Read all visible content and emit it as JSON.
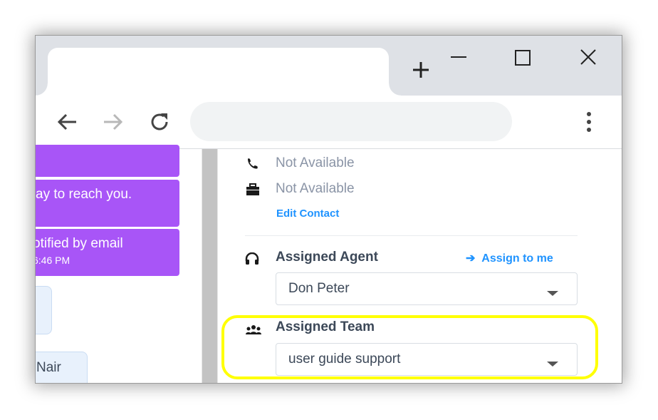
{
  "browser": {
    "new_tab_symbol": "+",
    "omnibox_value": "",
    "icons": [
      "new-tab-icon",
      "minimize-icon",
      "maximize-icon",
      "close-icon",
      "back-icon",
      "forward-icon",
      "reload-icon",
      "kebab-menu-icon"
    ]
  },
  "chat": {
    "messages": [
      {
        "text": "",
        "time": ""
      },
      {
        "text": "ay to reach you.",
        "time": ""
      },
      {
        "text": "otified by email",
        "time": "6:46 PM"
      }
    ],
    "contact_bubble": "Nair",
    "bubble_color": "#a855f7"
  },
  "contact": {
    "phone": "Not Available",
    "company": "Not Available",
    "edit_link": "Edit Contact"
  },
  "agent": {
    "title": "Assigned Agent",
    "assign_link": "Assign to me",
    "arrow": "➔",
    "selected": "Don Peter"
  },
  "team": {
    "title": "Assigned Team",
    "selected": "user guide support",
    "highlight_color": "#ffff00"
  },
  "colors": {
    "link": "#1f93ff",
    "text": "#3c4858",
    "muted": "#8a94a6"
  }
}
